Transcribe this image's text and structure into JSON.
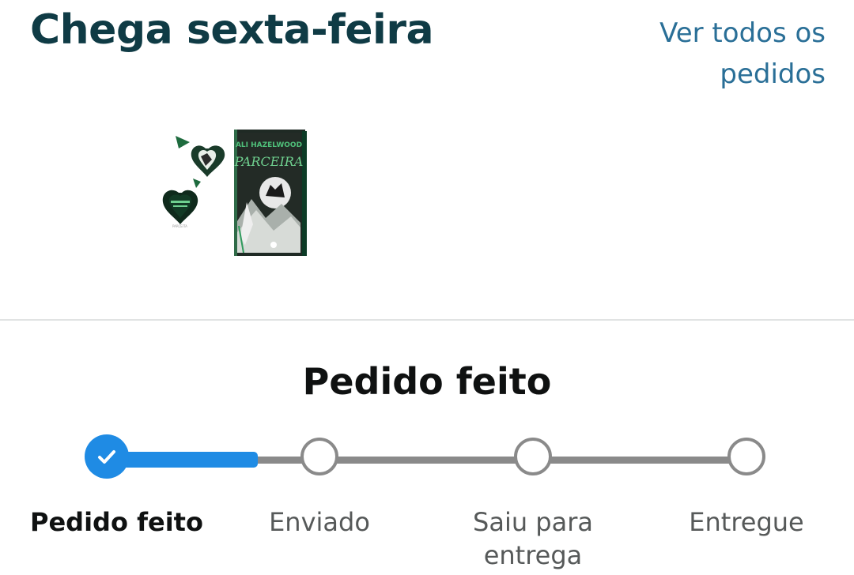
{
  "header": {
    "title": "Chega sexta-feira",
    "view_all_link": "Ver todos os pedidos"
  },
  "product": {
    "image_alt": "Parceira — Ali Hazelwood (livro)",
    "cover_author": "ALI HAZELWOOD",
    "cover_title": "PARCEIRA"
  },
  "status": {
    "title": "Pedido feito"
  },
  "tracker": {
    "accent_color": "#1f8be4",
    "inactive_color": "#8a8a8a",
    "completed_steps": 1,
    "steps": [
      {
        "label": "Pedido feito",
        "state": "done"
      },
      {
        "label": "Enviado",
        "state": "pending"
      },
      {
        "label": "Saiu para entrega",
        "state": "pending"
      },
      {
        "label": "Entregue",
        "state": "pending"
      }
    ]
  },
  "colors": {
    "title": "#0f3b45",
    "link": "#2a6f97",
    "divider": "#e1e3e3"
  }
}
